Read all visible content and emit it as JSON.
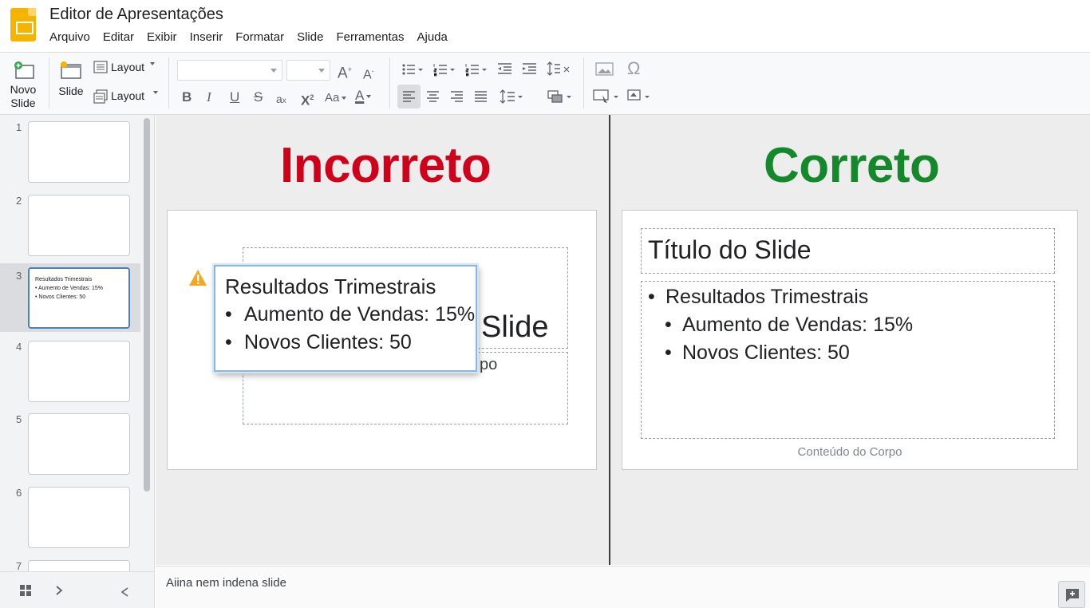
{
  "app": {
    "title": "Editor de Apresentações"
  },
  "menu": [
    "Arquivo",
    "Editar",
    "Exibir",
    "Inserir",
    "Formatar",
    "Slide",
    "Ferramentas",
    "Ajuda"
  ],
  "toolbar": {
    "new_slide_line1": "Novo",
    "new_slide_line2": "Slide",
    "slide_label": "Slide",
    "layout_label_1": "Layout",
    "layout_label_2": "Layout",
    "font_case_label": "Aa",
    "icons": [
      "new-slide-icon",
      "slide-icon",
      "layout-icon",
      "font-size-increase-icon",
      "font-size-decrease-icon",
      "bulleted-list-icon",
      "numbered-list-icon",
      "indent-decrease-icon",
      "indent-increase-icon",
      "line-spacing-icon",
      "image-icon",
      "special-chars-icon",
      "bold-icon",
      "italic-icon",
      "underline-icon",
      "strikethrough-icon",
      "clear-formatting-icon",
      "superscript-icon",
      "text-color-icon",
      "align-left-icon",
      "align-center-icon",
      "align-right-icon",
      "justify-icon",
      "fill-color-icon",
      "border-icon",
      "shape-icon"
    ]
  },
  "filmstrip": {
    "numbers": [
      "1",
      "2",
      "3",
      "4",
      "5",
      "6",
      "7"
    ],
    "selected_index": 3,
    "thumb3": {
      "title": "Resultados Trimestrais",
      "item1": "Aumento de Vendas: 15%",
      "item2": "Novos Clientes: 50"
    }
  },
  "compare": {
    "wrong": {
      "heading": "Incorreto",
      "bg_title_fragment": "Slide",
      "bg_body_fragment": "po",
      "popup_title": "Resultados Trimestrais",
      "popup_item1": "Aumento de Vendas: 15%",
      "popup_item2": "Novos Clientes: 50"
    },
    "right": {
      "heading": "Correto",
      "title": "Título do Slide",
      "list_title": "Resultados Trimestrais",
      "item1": "Aumento de Vendas: 15%",
      "item2": "Novos Clientes: 50",
      "caption": "Conteúdo do Corpo"
    }
  },
  "notes": {
    "text": "Aiina nem indena slide"
  },
  "colors": {
    "wrong": "#d0021b",
    "right": "#14882a",
    "accent_logo": "#f4b400",
    "selection": "#4a7fc0"
  }
}
